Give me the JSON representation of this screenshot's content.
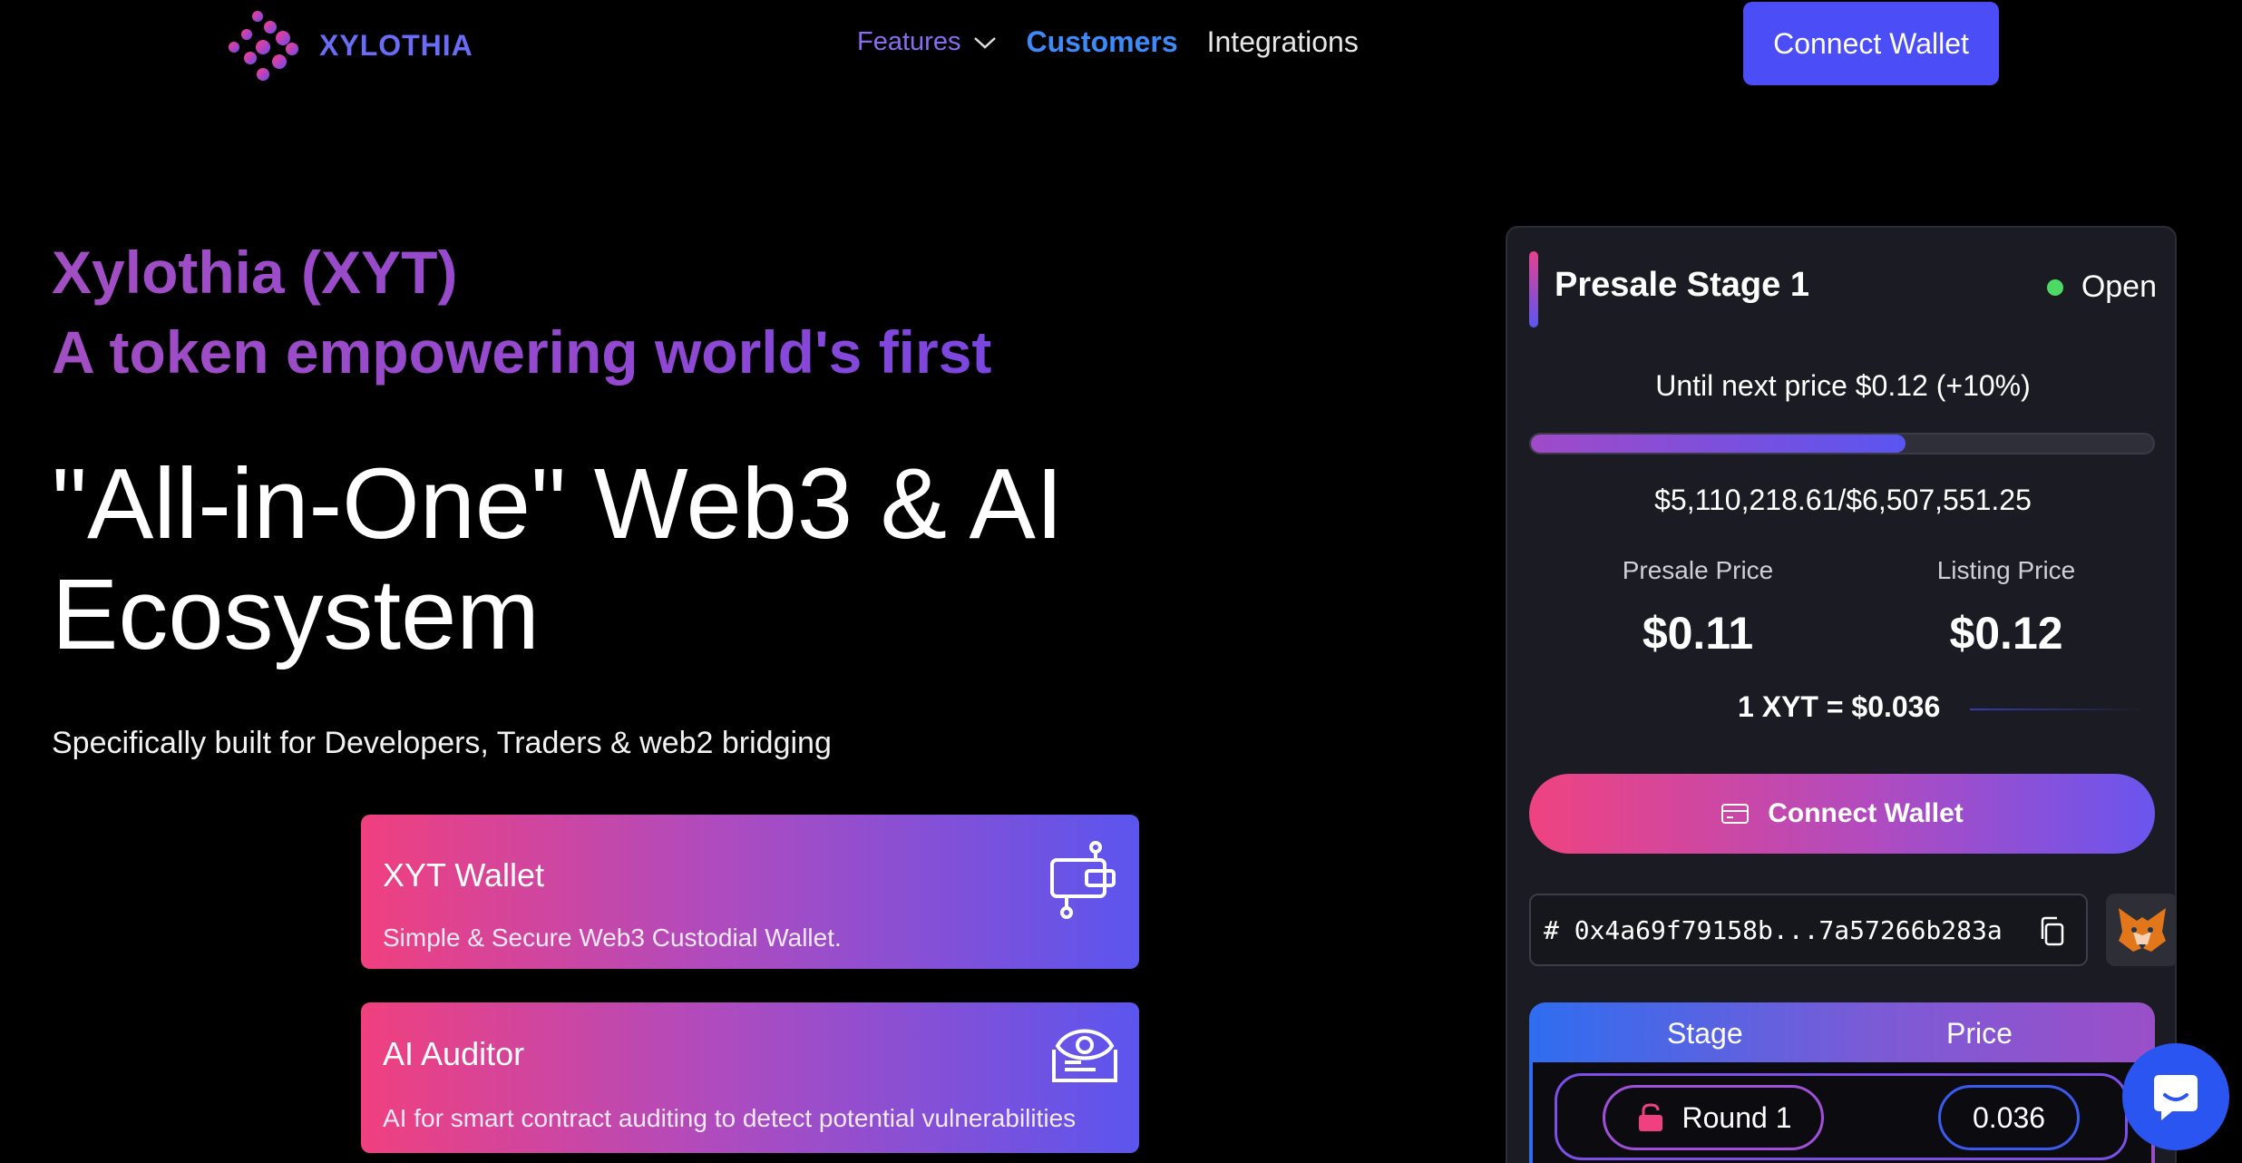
{
  "nav": {
    "brand": "XYLOTHIA",
    "links": [
      {
        "label": "Features"
      },
      {
        "label": "Customers"
      },
      {
        "label": "Integrations"
      }
    ],
    "cta": "Connect Wallet"
  },
  "hero": {
    "title_line1": "Xylothia (XYT)",
    "title_line2": "A token empowering world's first",
    "main_line1": "\"All-in-One\" Web3 & AI",
    "main_line2": "Ecosystem",
    "subtitle": "Specifically built for Developers, Traders & web2 bridging"
  },
  "features": [
    {
      "title": "XYT Wallet",
      "description": "Simple & Secure Web3 Custodial Wallet.",
      "icon": "wallet-icon"
    },
    {
      "title": "AI Auditor",
      "description": "AI for smart contract auditing to detect potential vulnerabilities",
      "icon": "eye-document-icon"
    }
  ],
  "presale": {
    "stage_title": "Presale Stage 1",
    "status": "Open",
    "until_next": "Until next price $0.12 (+10%)",
    "progress_fraction": 0.6024,
    "raised": "$5,110,218.61/$6,507,551.25",
    "presale_price_label": "Presale Price",
    "presale_price": "$0.11",
    "listing_price_label": "Listing Price",
    "listing_price": "$0.12",
    "rate": "1 XYT = $0.036",
    "connect_button": "Connect Wallet",
    "address": "# 0x4a69f79158b...7a57266b283a",
    "table": {
      "headers": [
        "Stage",
        "Price"
      ],
      "rows": [
        {
          "stage": "Round 1",
          "price": "0.036"
        }
      ]
    }
  },
  "colors": {
    "accent": "#4b4df7",
    "gradient_start": "#f0407f",
    "gradient_end": "#5b55ee",
    "status_open": "#4cd964"
  }
}
